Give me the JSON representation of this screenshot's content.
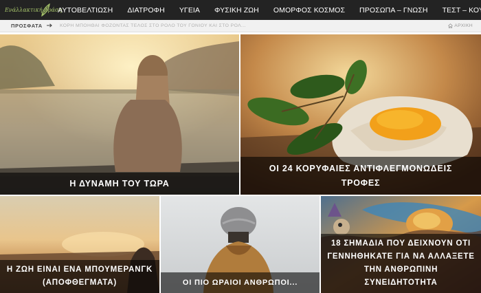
{
  "header": {
    "logo_text": "Ενάλλακτική Δράση",
    "nav": [
      {
        "label": "ΑΥΤΟΒΕΛΤΙΩΣΗ"
      },
      {
        "label": "ΔΙΑΤΡΟΦΗ"
      },
      {
        "label": "ΥΓΕΙΑ"
      },
      {
        "label": "ΦΥΣΙΚΗ ΖΩΗ"
      },
      {
        "label": "ΟΜΟΡΦΟΣ ΚΟΣΜΟΣ"
      },
      {
        "label": "ΠΡΟΣΩΠΑ – ΓΝΩΣΗ"
      },
      {
        "label": "ΤΕΣΤ – ΚΟΥΙΖ"
      }
    ]
  },
  "ticker": {
    "label": "ΠΡΟΣΦΑΤΑ",
    "headline": "ΚΟΡΗ ΜΠΟΗΘΑΙ ΦΟΖΟΝΤΑΣ ΤΕΛΟΣ ΣΤΟ ΡΟΛΟ ΤΟΥ ΓΟΝΙΟΥ ΚΑΙ ΣΤΟ ΡΟΛ...",
    "home_label": "ΑΡΧΙΚΗ"
  },
  "articles": [
    {
      "title_lines": [
        "Η ΔΥΝΑΜΗ ΤΟΥ ΤΩΡΑ"
      ]
    },
    {
      "title_lines": [
        "ΟΙ 24 ΚΟΡΥΦΑΙΕΣ ΑΝΤΙΦΛΕΓΜΟΝΩΔΕΙΣ",
        "ΤΡΟΦΕΣ"
      ]
    },
    {
      "title_lines": [
        "Η ΖΩΗ ΕΙΝΑΙ ΕΝΑ ΜΠΟΥΜΕΡΑΝΓΚ",
        "(ΑΠΟΦΘΕΓΜΑΤΑ)"
      ]
    },
    {
      "title_lines": [
        "ΟΙ ΠΙΟ ΩΡΑΙΟΙ ΑΝΘΡΩΠΟΙ..."
      ]
    },
    {
      "title_lines": [
        "18 ΣΗΜΑΔΙΑ ΠΟΥ ΔΕΙΧΝΟΥΝ ΟΤΙ",
        "ΓΕΝΝΗΘΗΚΑΤΕ ΓΙΑ ΝΑ ΑΛΛΑΞΕΤΕ",
        "ΤΗΝ ΑΝΘΡΩΠΙΝΗ",
        "ΣΥΝΕΙΔΗΤΟΤΗΤΑ"
      ]
    }
  ],
  "colors": {
    "nav_bg": "#232323",
    "ticker_bg": "#f1f1f1",
    "logo_green": "#a8c66c",
    "caption_overlay": "rgba(0,0,0,0.58)"
  },
  "icons": {
    "logo": "leaf-logo-icon",
    "ticker": "arrow-right-icon",
    "home": "home-icon"
  }
}
